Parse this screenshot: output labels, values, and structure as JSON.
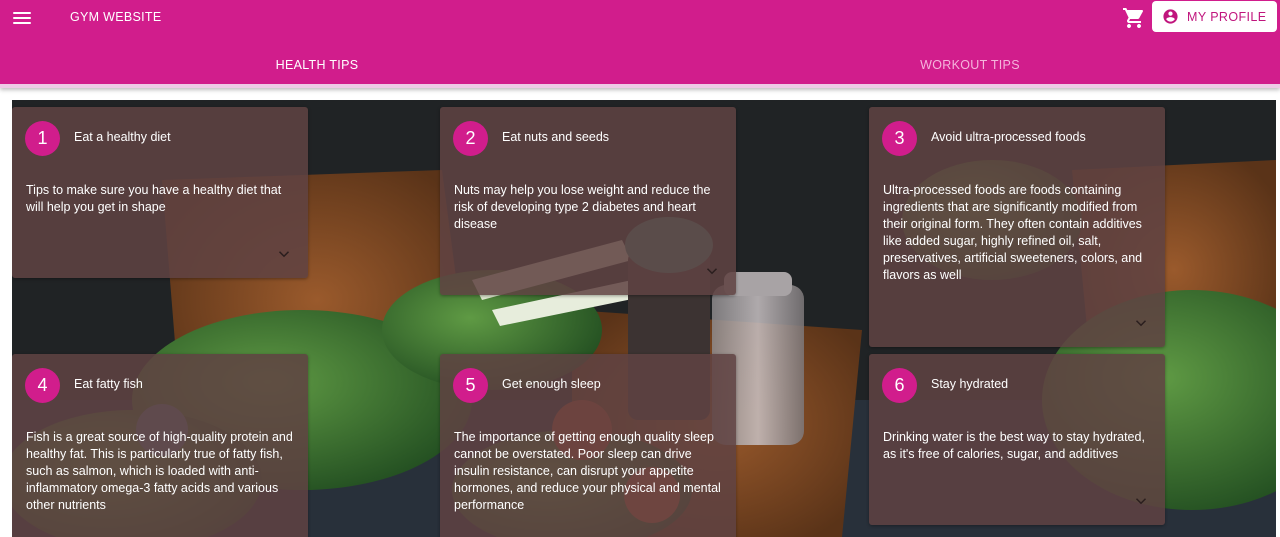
{
  "appbar": {
    "title": "GYM WEBSITE",
    "menu_icon": "menu-icon",
    "cart_icon": "cart-icon",
    "profile_label": "MY PROFILE",
    "profile_icon": "account-circle-icon"
  },
  "tabs": [
    {
      "label": "HEALTH TIPS",
      "active": true
    },
    {
      "label": "WORKOUT TIPS",
      "active": false
    }
  ],
  "tips": [
    {
      "number": "1",
      "title": "Eat a healthy diet",
      "text": "Tips to make sure you have a healthy diet that will help you get in shape"
    },
    {
      "number": "2",
      "title": "Eat nuts and seeds",
      "text": "Nuts may help you lose weight and reduce the risk of developing type 2 diabetes and heart disease"
    },
    {
      "number": "3",
      "title": "Avoid ultra-processed foods",
      "text": "Ultra-processed foods are foods containing ingredients that are significantly modified from their original form. They often contain additives like added sugar, highly refined oil, salt, preservatives, artificial sweeteners, colors, and flavors as well"
    },
    {
      "number": "4",
      "title": "Eat fatty fish",
      "text": "Fish is a great source of high-quality protein and healthy fat. This is particularly true of fatty fish, such as salmon, which is loaded with anti-inflammatory omega-3 fatty acids and various other nutrients"
    },
    {
      "number": "5",
      "title": "Get enough sleep",
      "text": "The importance of getting enough quality sleep cannot be overstated. Poor sleep can drive insulin resistance, can disrupt your appetite hormones, and reduce your physical and mental performance"
    },
    {
      "number": "6",
      "title": "Stay hydrated",
      "text": "Drinking water is the best way to stay hydrated, as it's free of calories, sugar, and additives"
    }
  ],
  "colors": {
    "primary": "#d11d8c",
    "card_background": "#604242",
    "tab_inactive": "#f5b4dc"
  }
}
